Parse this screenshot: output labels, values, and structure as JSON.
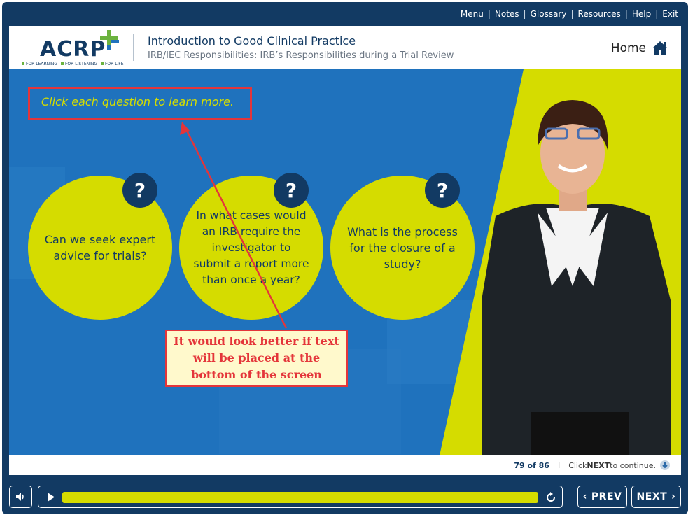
{
  "topnav": {
    "items": [
      "Menu",
      "Notes",
      "Glossary",
      "Resources",
      "Help",
      "Exit"
    ],
    "separator": "|"
  },
  "header": {
    "logo_text": "ACRP",
    "logo_tagline": [
      "FOR LEARNING",
      "FOR LISTENING",
      "FOR LIFE"
    ],
    "course_title": "Introduction to Good Clinical Practice",
    "course_subtitle": "IRB/IEC Responsibilities: IRB’s Responsibilities during a Trial Review",
    "home_label": "Home",
    "home_icon": "home-icon"
  },
  "slide": {
    "instruction": "Click each question to learn more.",
    "badge_glyph": "?",
    "questions": [
      {
        "text": "Can we seek expert advice for trials?"
      },
      {
        "text": "In what cases would an IRB require the investigator to submit a report more than once a year?"
      },
      {
        "text": "What is the process for the closure of a study?"
      }
    ],
    "review_callout": "It would look better if text will be placed at the bottom of the screen"
  },
  "footer": {
    "page_current": "79 of 86",
    "separator": "I",
    "continue_prefix": "Click ",
    "continue_key": "NEXT",
    "continue_suffix": " to continue."
  },
  "controls": {
    "prev_label": "PREV",
    "next_label": "NEXT",
    "progress": 1.0
  },
  "colors": {
    "navy": "#123a63",
    "stage_blue": "#1f72bd",
    "accent_yellow": "#d5dc00",
    "annotation_red": "#e4353a",
    "callout_bg": "#fff9cc"
  }
}
